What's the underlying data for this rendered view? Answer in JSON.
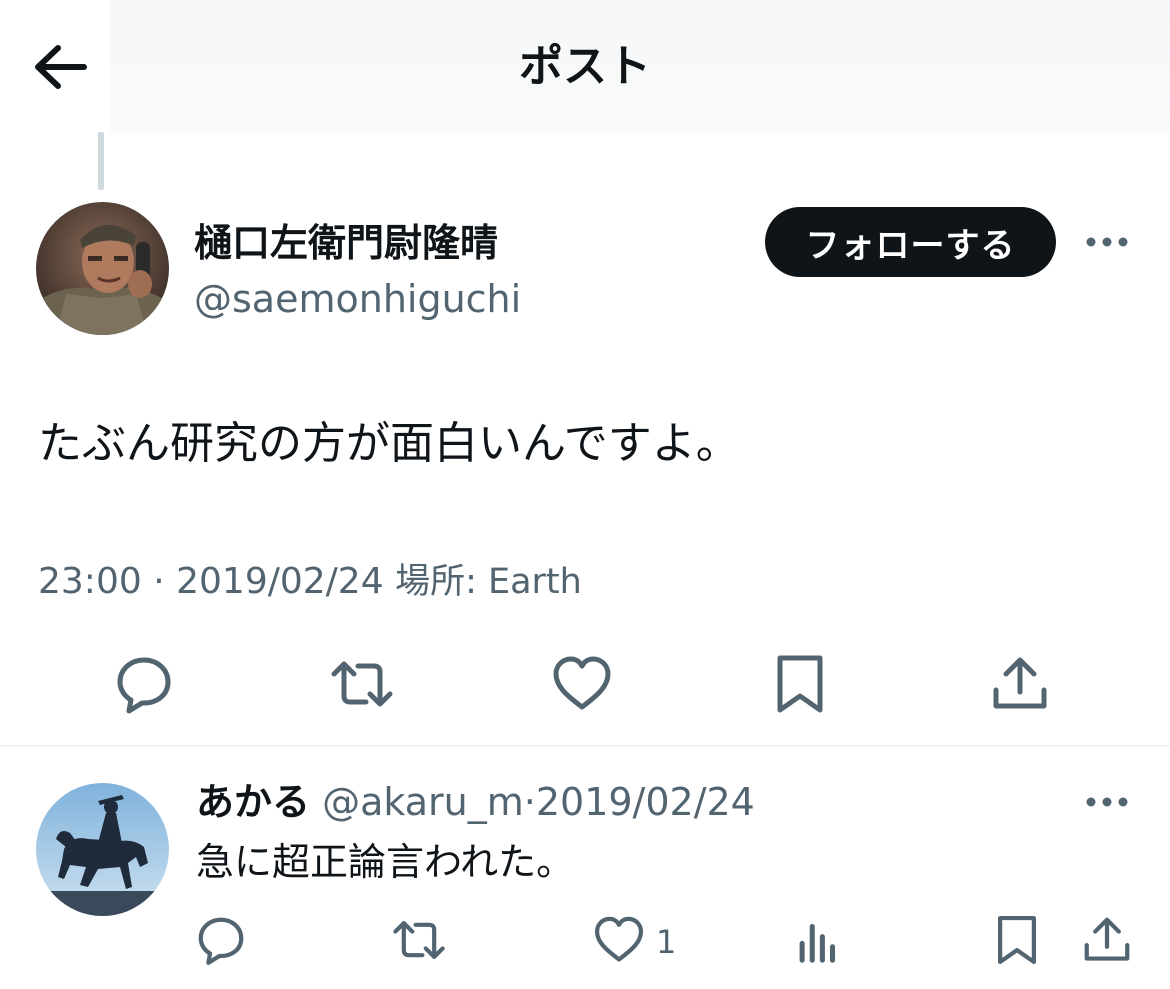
{
  "header": {
    "title": "ポスト",
    "back_icon": "arrow-left-icon"
  },
  "post": {
    "author": {
      "display_name": "樋口左衛門尉隆晴",
      "handle": "@saemonhiguchi"
    },
    "follow_label": "フォローする",
    "text": "たぶん研究の方が面白いんですよ。",
    "meta": {
      "time": "23:00",
      "separator": "·",
      "date": "2019/02/24",
      "location": "場所: Earth"
    },
    "actions": [
      "reply-icon",
      "retweet-icon",
      "like-icon",
      "bookmark-icon",
      "share-icon"
    ]
  },
  "reply": {
    "author": {
      "display_name": "あかる",
      "handle": "@akaru_m"
    },
    "separator": "·",
    "date": "2019/02/24",
    "text": "急に超正論言われた。",
    "like_count": "1",
    "actions": [
      "reply-icon",
      "retweet-icon",
      "like-icon",
      "views-icon",
      "bookmark-icon",
      "share-icon"
    ]
  },
  "colors": {
    "text_primary": "#0f1419",
    "text_secondary": "#536471",
    "follow_button_bg": "#0f1419",
    "divider": "#eff3f4"
  }
}
